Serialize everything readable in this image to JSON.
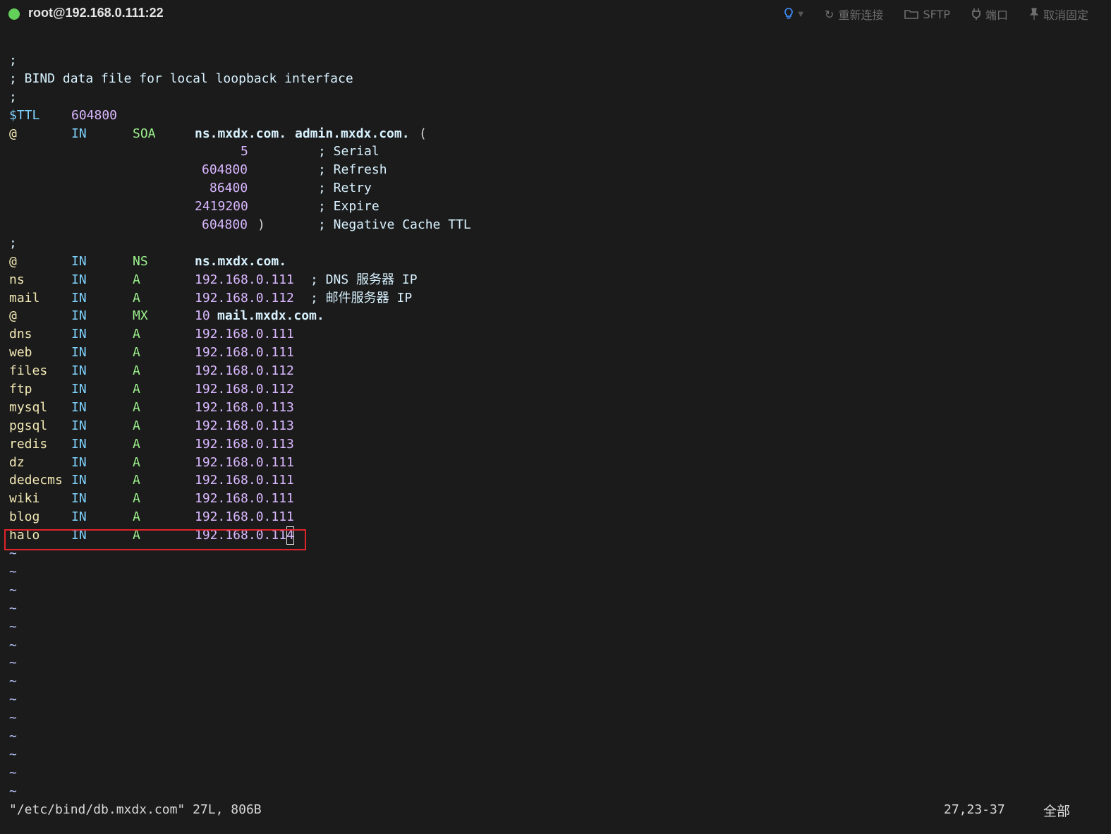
{
  "titlebar": {
    "session": "root@192.168.0.111:22",
    "status_color": "#63d159",
    "hint_icon": "lightbulb-icon",
    "buttons": [
      {
        "icon": "refresh-icon",
        "label": "重新连接"
      },
      {
        "icon": "folder-icon",
        "label": "SFTP"
      },
      {
        "icon": "plug-icon",
        "label": "端口"
      },
      {
        "icon": "pin-icon",
        "label": "取消固定"
      }
    ]
  },
  "editor": {
    "header": [
      ";",
      "; BIND data file for local loopback interface",
      ";"
    ],
    "ttl": {
      "key": "$TTL",
      "value": "604800"
    },
    "soa": {
      "name": "@",
      "class": "IN",
      "type": "SOA",
      "primary": "ns.mxdx.com.",
      "admin": "admin.mxdx.com.",
      "open": "(",
      "fields": [
        {
          "value": "5",
          "comment": "; Serial"
        },
        {
          "value": "604800",
          "comment": "; Refresh"
        },
        {
          "value": "86400",
          "comment": "; Retry"
        },
        {
          "value": "2419200",
          "comment": "; Expire"
        },
        {
          "value": "604800",
          "close": ")",
          "comment": "; Negative Cache TTL"
        }
      ]
    },
    "separator": ";",
    "ns_record": {
      "name": "@",
      "class": "IN",
      "type": "NS",
      "data": "ns.mxdx.com."
    },
    "commented_records": [
      {
        "name": "ns",
        "class": "IN",
        "type": "A",
        "data": "192.168.0.111",
        "comment": "; DNS 服务器 IP"
      },
      {
        "name": "mail",
        "class": "IN",
        "type": "A",
        "data": "192.168.0.112",
        "comment": "; 邮件服务器 IP"
      }
    ],
    "mx_record": {
      "name": "@",
      "class": "IN",
      "type": "MX",
      "priority": "10",
      "data": "mail.mxdx.com."
    },
    "records": [
      {
        "name": "dns",
        "class": "IN",
        "type": "A",
        "data": "192.168.0.111"
      },
      {
        "name": "web",
        "class": "IN",
        "type": "A",
        "data": "192.168.0.111"
      },
      {
        "name": "files",
        "class": "IN",
        "type": "A",
        "data": "192.168.0.112"
      },
      {
        "name": "ftp",
        "class": "IN",
        "type": "A",
        "data": "192.168.0.112"
      },
      {
        "name": "mysql",
        "class": "IN",
        "type": "A",
        "data": "192.168.0.113"
      },
      {
        "name": "pgsql",
        "class": "IN",
        "type": "A",
        "data": "192.168.0.113"
      },
      {
        "name": "redis",
        "class": "IN",
        "type": "A",
        "data": "192.168.0.113"
      },
      {
        "name": "dz",
        "class": "IN",
        "type": "A",
        "data": "192.168.0.111"
      },
      {
        "name": "dedecms",
        "class": "IN",
        "type": "A",
        "data": "192.168.0.111"
      },
      {
        "name": "wiki",
        "class": "IN",
        "type": "A",
        "data": "192.168.0.111"
      },
      {
        "name": "blog",
        "class": "IN",
        "type": "A",
        "data": "192.168.0.111"
      }
    ],
    "current_record": {
      "name": "halo",
      "class": "IN",
      "type": "A",
      "data_before_cursor": "192.168.0.11",
      "cursor_char": "4"
    },
    "tilde": "~",
    "empty_lines": 14
  },
  "statusline": {
    "file": "\"/etc/bind/db.mxdx.com\" 27L, 806B",
    "position": "27,23-37",
    "scroll": "全部"
  },
  "colors": {
    "background": "#1b1b1b",
    "highlight_border": "#e0242b"
  }
}
